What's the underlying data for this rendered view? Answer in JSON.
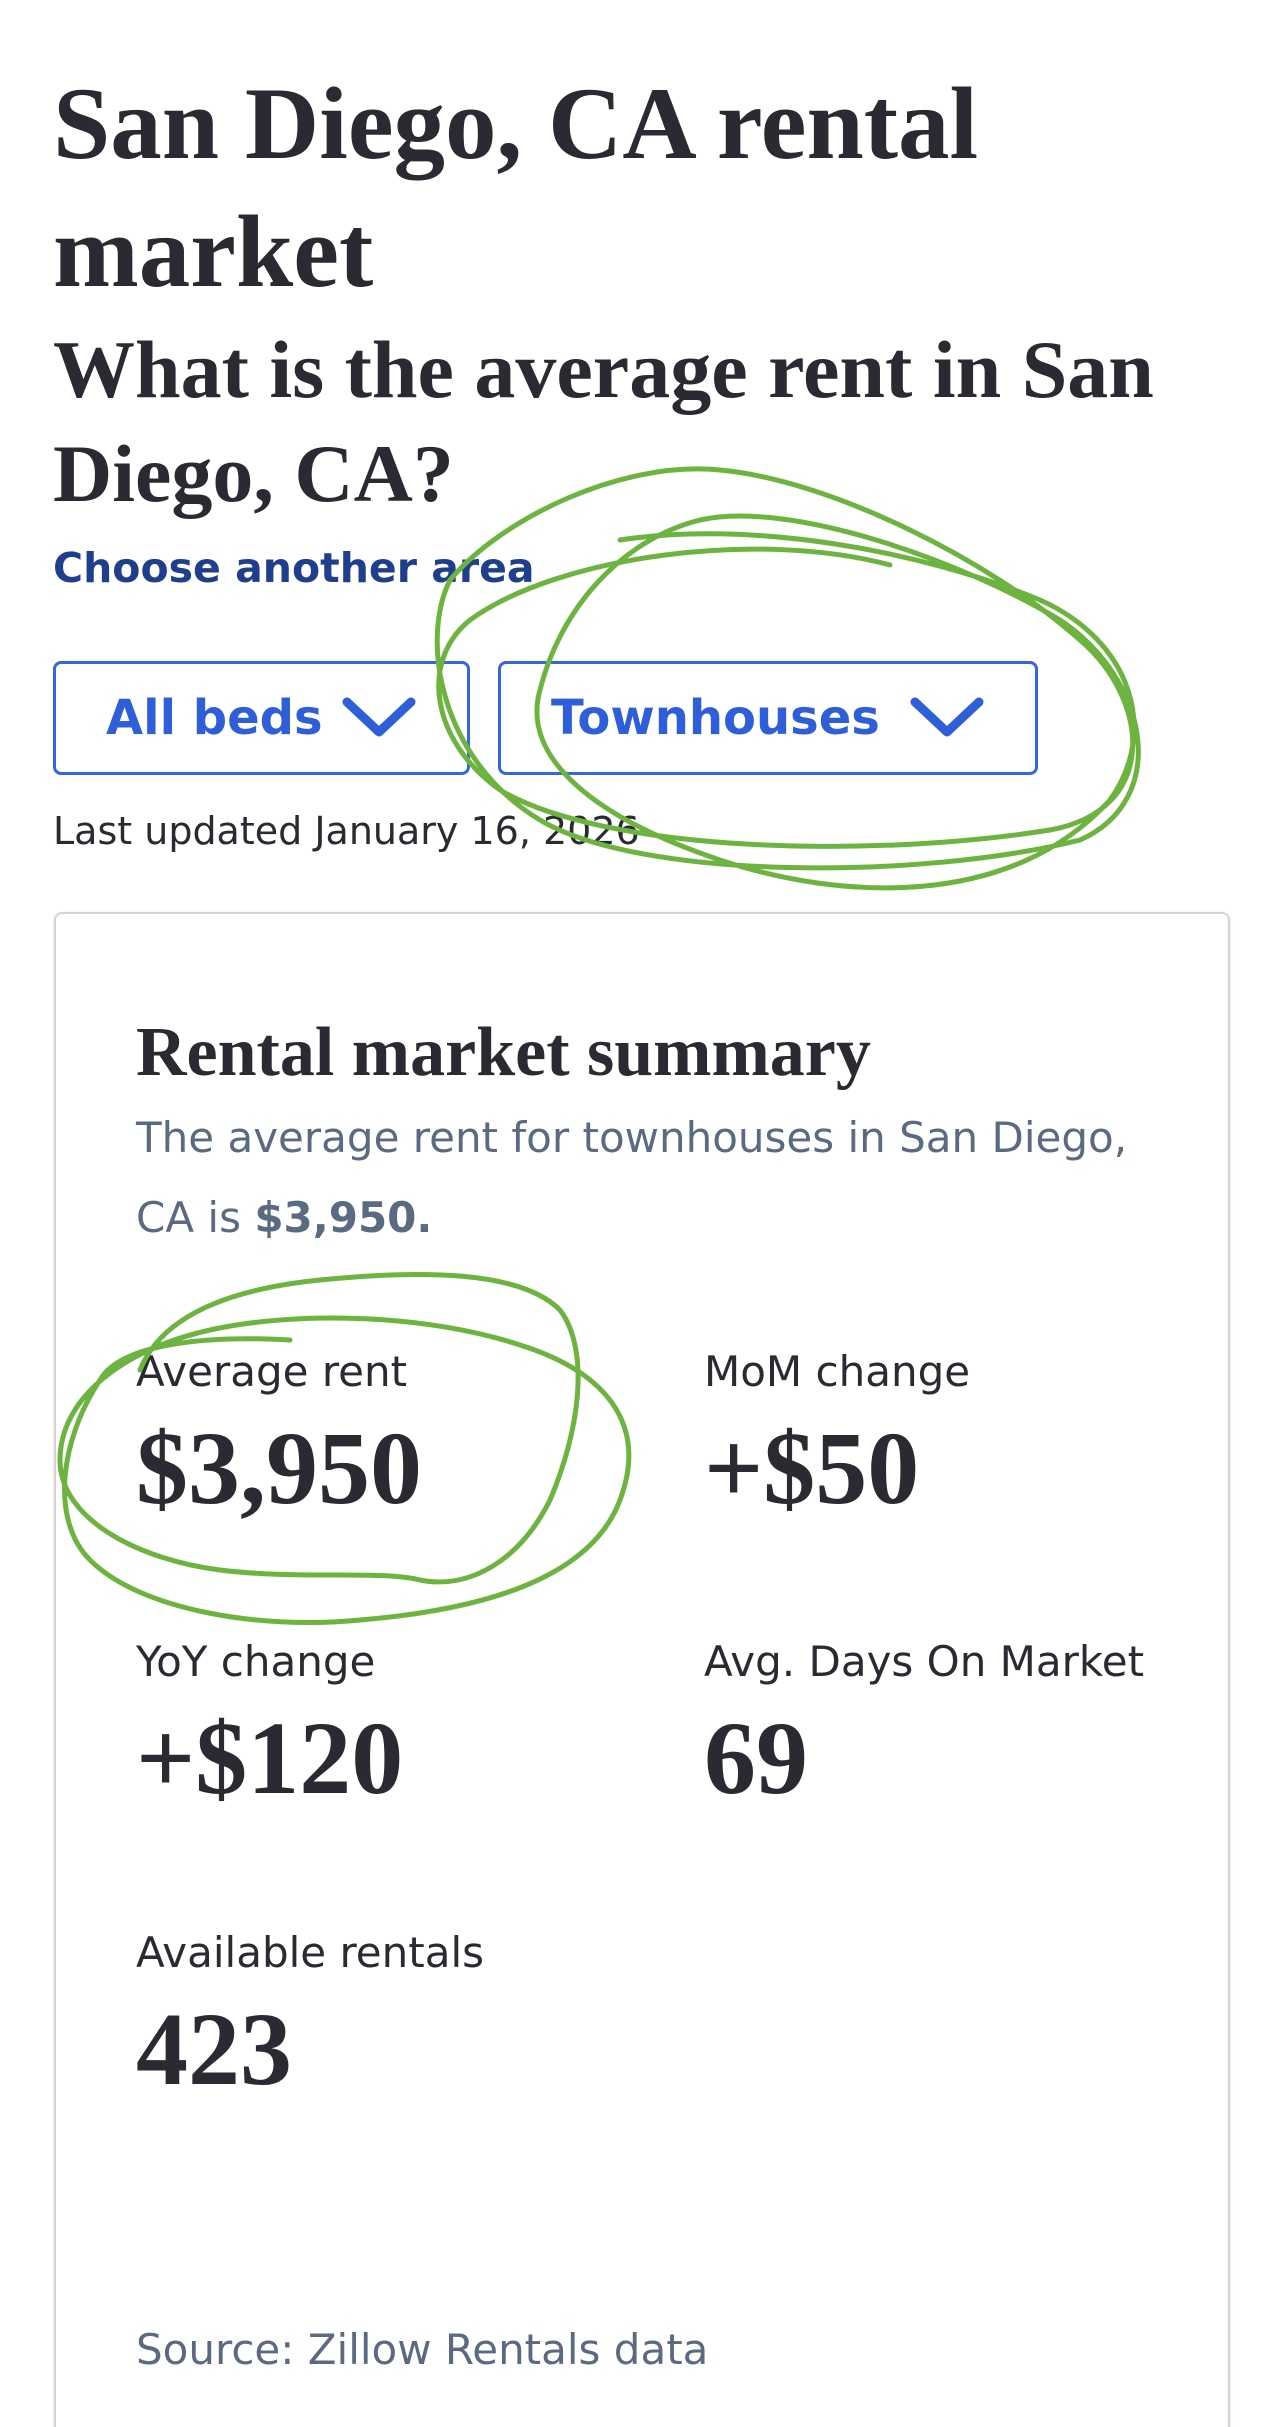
{
  "page": {
    "title": "San Diego, CA rental market",
    "subtitle": "What is the average rent in San Diego, CA?",
    "choose_area_link": "Choose another area",
    "last_updated": "Last updated January 16, 2026"
  },
  "filters": {
    "beds": {
      "selected": "All beds",
      "icon": "chevron-down-icon"
    },
    "property_type": {
      "selected": "Townhouses",
      "icon": "chevron-down-icon"
    }
  },
  "summary": {
    "title": "Rental market summary",
    "description_prefix": "The average rent for townhouses in San Diego, CA is ",
    "description_value": "$3,950.",
    "stats": {
      "average_rent": {
        "label": "Average rent",
        "value": "$3,950"
      },
      "mom_change": {
        "label": "MoM change",
        "value": "+$50"
      },
      "yoy_change": {
        "label": "YoY change",
        "value": "+$120"
      },
      "avg_days_on_market": {
        "label": "Avg. Days On Market",
        "value": "69"
      },
      "available_rentals": {
        "label": "Available rentals",
        "value": "423"
      }
    },
    "source": "Source: Zillow Rentals data"
  },
  "colors": {
    "link": "#1f3f8c",
    "dropdown_accent": "#2f5fd8",
    "heading_text": "#2a2a33",
    "muted_text": "#5a6a80",
    "annotation": "#6db33f"
  }
}
